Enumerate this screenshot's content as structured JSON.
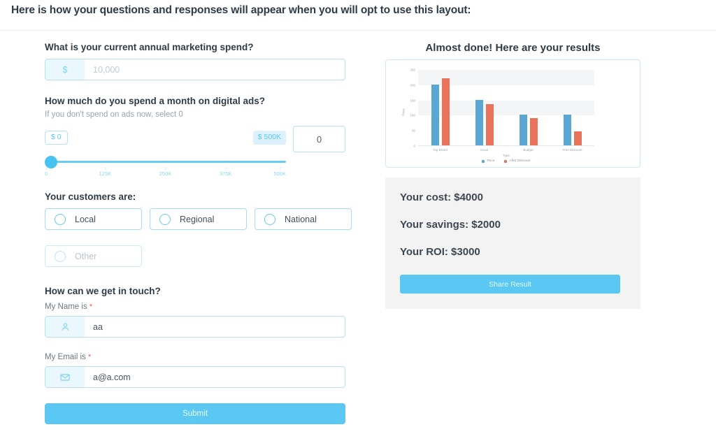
{
  "header": {
    "title": "Here is how your questions and responses will appear when you will opt to use this layout:"
  },
  "form": {
    "spend_question": "What is your current annual marketing spend?",
    "spend_prefix": "$",
    "spend_placeholder": "10,000",
    "spend_value": "",
    "ads_question": "How much do you spend a month on digital ads?",
    "ads_hint": "If you don't spend on ads now, select 0",
    "slider_min_label": "$ 0",
    "slider_max_label": "$ 500K",
    "slider_value": "0",
    "slider_ticks": [
      "0",
      "125K",
      "250K",
      "375K",
      "500K"
    ],
    "customers_question": "Your customers are:",
    "customer_options": [
      {
        "label": "Local",
        "disabled": false
      },
      {
        "label": "Regional",
        "disabled": false
      },
      {
        "label": "National",
        "disabled": false
      },
      {
        "label": "Other",
        "disabled": true
      }
    ],
    "contact_question": "How can we get in touch?",
    "name_label": "My Name is",
    "name_required_marker": "*",
    "name_value": "aa",
    "name_icon": "user-icon",
    "email_label": "My Email is",
    "email_required_marker": "*",
    "email_value": "a@a.com",
    "email_icon": "envelope-icon",
    "submit_label": "Submit"
  },
  "results": {
    "title": "Almost done! Here are your results",
    "cost_line": "Your cost: $4000",
    "savings_line": "Your savings: $2000",
    "roi_line": "Your ROI: $3000",
    "share_label": "Share Result"
  },
  "colors": {
    "accent_blue": "#5ac8f2",
    "border_blue": "#b8e2f4",
    "prefix_bg": "#eaf7fd",
    "bar_price": "#5aa7d4",
    "bar_discount": "#e8725a",
    "required_red": "#ef5b5b",
    "results_bg": "#f3f3f3"
  },
  "chart_data": {
    "type": "bar",
    "title": "",
    "xlabel": "Type",
    "ylabel": "Price",
    "categories": [
      "Top Brand",
      "Good",
      "Budget",
      "Free Discount"
    ],
    "series": [
      {
        "name": "Price",
        "values": [
          200,
          150,
          100,
          100
        ],
        "color": "#5aa7d4"
      },
      {
        "name": "After Discount",
        "values": [
          220,
          135,
          90,
          45
        ],
        "color": "#e8725a"
      }
    ],
    "yticks": [
      0,
      50,
      100,
      150,
      200,
      250
    ],
    "ylim": [
      0,
      250
    ],
    "grid": false,
    "legend_position": "bottom"
  }
}
